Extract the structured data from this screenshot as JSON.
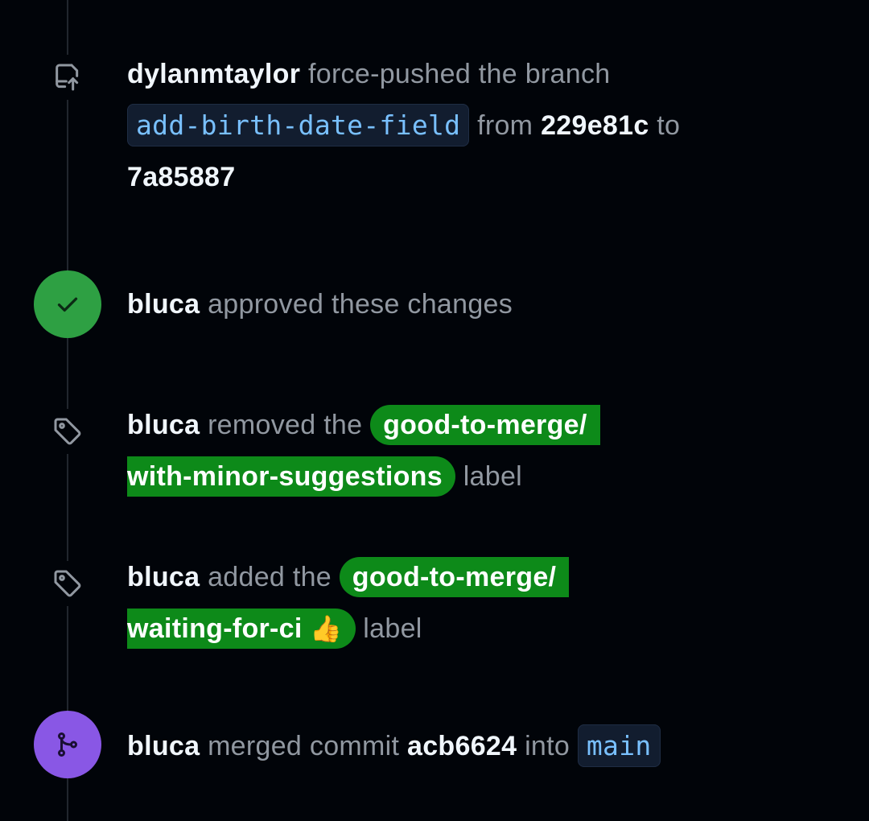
{
  "timeline": {
    "force_push": {
      "author": "dylanmtaylor",
      "action": "force-pushed the branch",
      "branch": "add-birth-date-field",
      "from_word": "from",
      "from_sha": "229e81c",
      "to_word": "to",
      "to_sha": "7a85887",
      "icon": "repo-push-icon"
    },
    "approved": {
      "author": "bluca",
      "action": "approved these changes",
      "icon": "check-icon",
      "badge_color": "#2ea043"
    },
    "label_removed": {
      "author": "bluca",
      "action": "removed the",
      "label_part1": "good-to-merge/",
      "label_part2": "with-minor-suggestions",
      "suffix": "label",
      "label_color": "#0d8a19",
      "icon": "tag-icon"
    },
    "label_added": {
      "author": "bluca",
      "action": "added the",
      "label_part1": "good-to-merge/",
      "label_part2": "waiting-for-ci",
      "label_emoji": "👍",
      "suffix": "label",
      "label_color": "#0d8a19",
      "icon": "tag-icon"
    },
    "merged": {
      "author": "bluca",
      "action": "merged commit",
      "commit": "acb6624",
      "into_word": "into",
      "branch": "main",
      "icon": "git-merge-icon",
      "badge_color": "#8957e5"
    }
  }
}
